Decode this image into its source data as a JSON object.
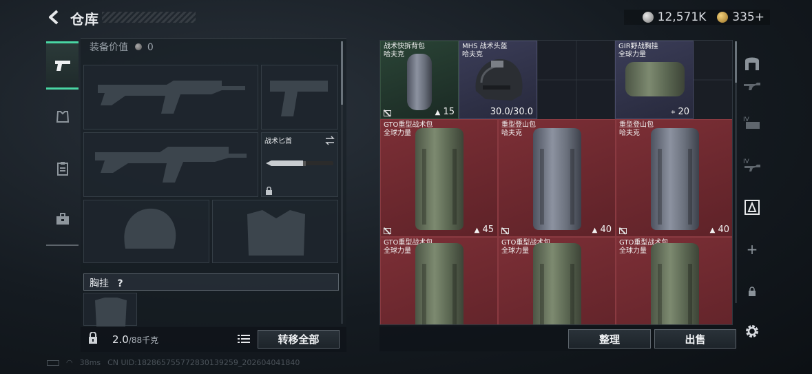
{
  "header": {
    "title": "仓库"
  },
  "currency": {
    "silver": "12,571K",
    "gold": "335+"
  },
  "loadout": {
    "value_label": "装备价值",
    "value": "0",
    "knife_slot": {
      "label": "战术匕首"
    },
    "rig_label": "胸挂",
    "rig_help": "?",
    "weight_current": "2.0",
    "weight_max": "/88千克",
    "transfer_all": "转移全部"
  },
  "storage": {
    "items": [
      {
        "name": "战术快拆背包",
        "origin": "哈夫克",
        "rarity": "green",
        "count": "15",
        "new": true
      },
      {
        "name": "MHS 战术头盔",
        "origin": "哈夫克",
        "rarity": "blue",
        "count": "30.0/30.0",
        "new": false
      },
      {
        "name": "GIR野战胸挂",
        "origin": "全球力量",
        "rarity": "blue",
        "count": "20",
        "new": false
      },
      {
        "name": "GTO重型战术包",
        "origin": "全球力量",
        "rarity": "red",
        "count": "45",
        "new": true
      },
      {
        "name": "重型登山包",
        "origin": "哈夫克",
        "rarity": "red",
        "count": "40",
        "new": true
      },
      {
        "name": "重型登山包",
        "origin": "哈夫克",
        "rarity": "red",
        "count": "40",
        "new": true
      },
      {
        "name": "GTO重型战术包",
        "origin": "全球力量",
        "rarity": "red",
        "count": "",
        "new": false
      },
      {
        "name": "GTO重型战术包",
        "origin": "全球力量",
        "rarity": "red",
        "count": "",
        "new": false
      },
      {
        "name": "GTO重型战术包",
        "origin": "全球力量",
        "rarity": "red",
        "count": "",
        "new": false
      }
    ]
  },
  "buttons": {
    "sort": "整理",
    "sell": "出售"
  },
  "status": {
    "ping": "38ms",
    "uid": "CN UID:18286575577283013925​9_202604041840"
  },
  "colors": {
    "accent": "#49d6a3",
    "red_rarity": "#7c2f36",
    "blue_rarity": "#3b3d58",
    "green_rarity": "#2a4436"
  }
}
